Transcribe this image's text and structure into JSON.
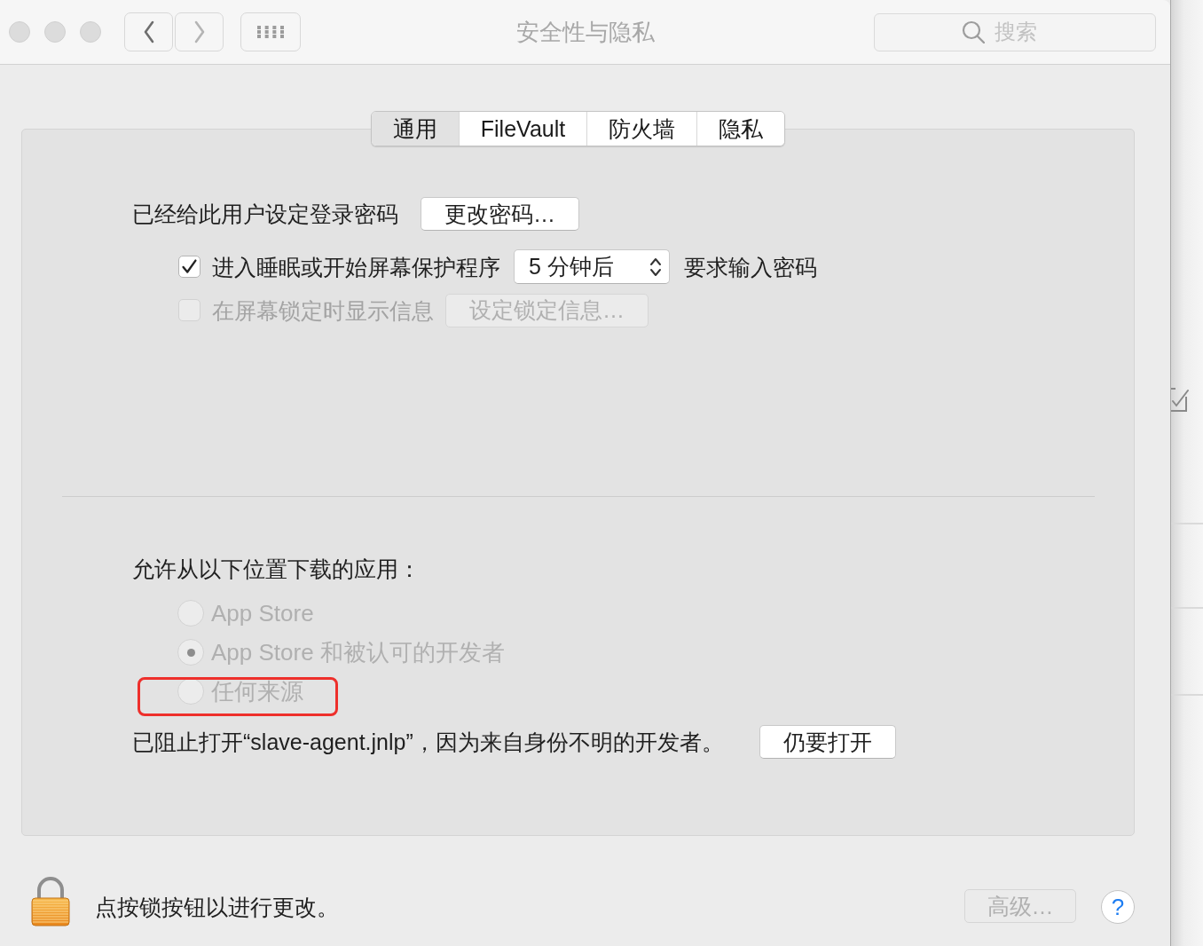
{
  "window": {
    "title": "安全性与隐私"
  },
  "navigation": [
    {
      "kind": "back",
      "disabled": false
    },
    {
      "kind": "forward",
      "disabled": true
    }
  ],
  "search": {
    "placeholder": "搜索"
  },
  "tabs": [
    {
      "label": "通用",
      "selected": true
    },
    {
      "label": "FileVault",
      "selected": false
    },
    {
      "label": "防火墙",
      "selected": false
    },
    {
      "label": "隐私",
      "selected": false
    }
  ],
  "password": {
    "label": "已经给此用户设定登录密码",
    "button": "更改密码…"
  },
  "options": [
    {
      "kind": "popup",
      "label": "进入睡眠或开始屏幕保护程序",
      "checked": true,
      "disabled": false,
      "popup_value": "5 分钟后",
      "suffix": "要求输入密码"
    },
    {
      "kind": "button",
      "label": "在屏幕锁定时显示信息",
      "checked": false,
      "disabled": true,
      "button": "设定锁定信息…"
    }
  ],
  "downloads": {
    "heading": "允许从以下位置下载的应用：",
    "disabled": true,
    "choices": [
      {
        "label": "App Store",
        "selected": false,
        "highlighted": false
      },
      {
        "label": "App Store 和被认可的开发者",
        "selected": true,
        "highlighted": false
      },
      {
        "label": "任何来源",
        "selected": false,
        "highlighted": true
      }
    ],
    "blocked_message": "已阻止打开“slave-agent.jnlp”，因为来自身份不明的开发者。",
    "open_button": "仍要打开"
  },
  "footer": {
    "locked": true,
    "lock_text": "点按锁按钮以进行更改。",
    "advanced_button": {
      "label": "高级…",
      "disabled": true
    },
    "help_label": "?"
  }
}
